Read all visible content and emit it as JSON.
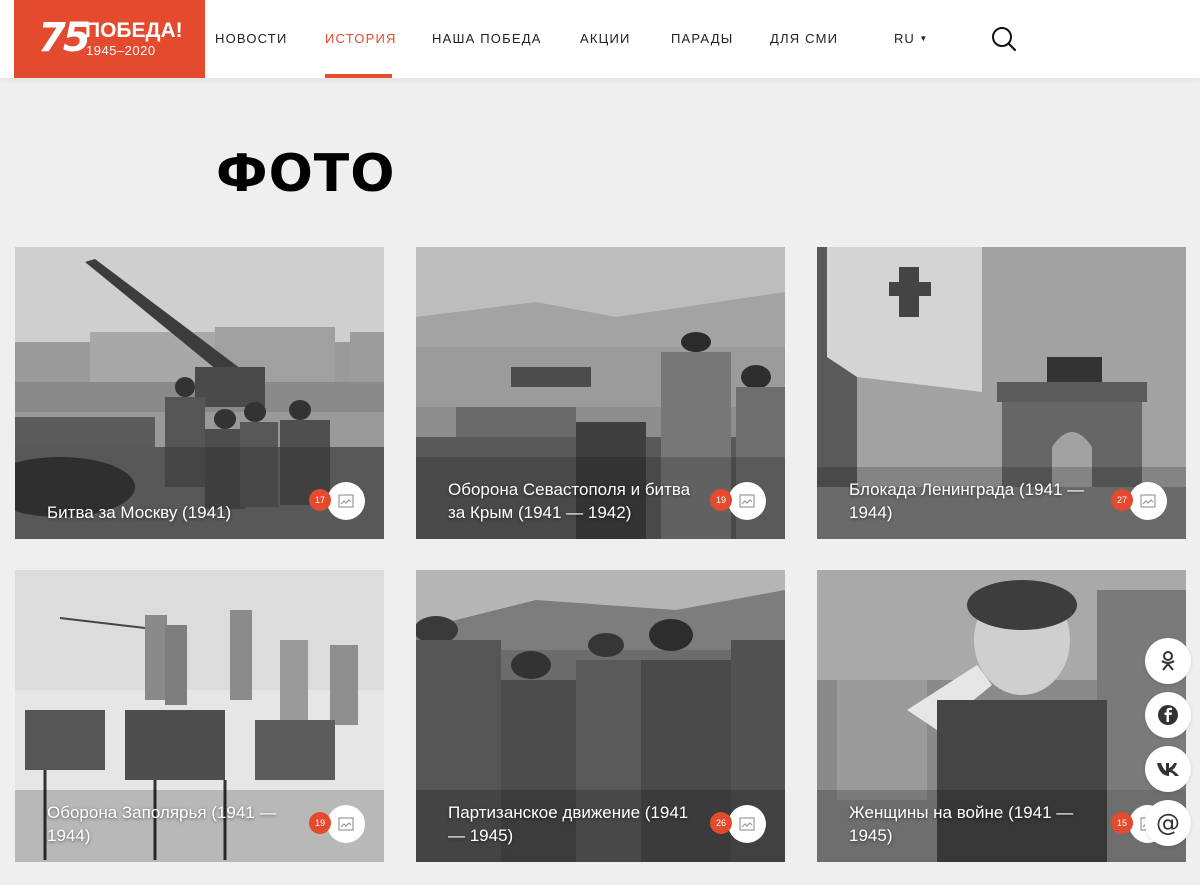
{
  "header": {
    "logo": {
      "number": "75",
      "title": "ПОБЕДА!",
      "years": "1945–2020"
    },
    "nav": [
      "НОВОСТИ",
      "ИСТОРИЯ",
      "НАША ПОБЕДА",
      "АКЦИИ",
      "ПАРАДЫ",
      "ДЛЯ СМИ"
    ],
    "active_nav": "ИСТОРИЯ",
    "language": "RU"
  },
  "page_title": "ФОТО",
  "cards": [
    {
      "title": "Битва за Москву (1941)",
      "count": "17"
    },
    {
      "title": "Оборона Севастополя и битва за Крым (1941 — 1942)",
      "count": "19"
    },
    {
      "title": "Блокада Ленинграда (1941 — 1944)",
      "count": "27"
    },
    {
      "title": "Оборона Заполярья (1941 — 1944)",
      "count": "19"
    },
    {
      "title": "Партизанское движение (1941 — 1945)",
      "count": "26"
    },
    {
      "title": "Женщины на войне (1941 — 1945)",
      "count": "15"
    }
  ],
  "social": [
    "odnoklassniki-icon",
    "facebook-icon",
    "vk-icon",
    "email-icon"
  ],
  "colors": {
    "accent": "#e34a2e",
    "background": "#efefef"
  }
}
